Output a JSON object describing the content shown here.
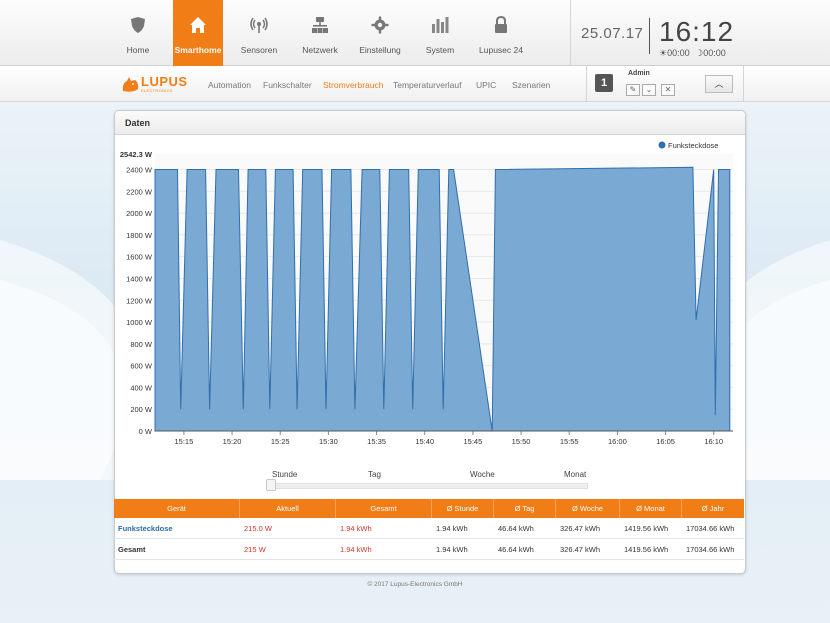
{
  "nav": {
    "items": [
      {
        "label": "Home",
        "icon": "shield-icon"
      },
      {
        "label": "Smarthome",
        "icon": "house-icon",
        "active": true
      },
      {
        "label": "Sensoren",
        "icon": "signal-icon"
      },
      {
        "label": "Netzwerk",
        "icon": "network-icon"
      },
      {
        "label": "Einstellung",
        "icon": "gear-icon"
      },
      {
        "label": "System",
        "icon": "bars-icon"
      },
      {
        "label": "Lupusec 24",
        "icon": "lock-icon"
      }
    ],
    "active_color": "#f07d16"
  },
  "clock": {
    "date": "25.07.17",
    "time": "16:12",
    "sunrise": "00:00",
    "sunset": "00:00"
  },
  "subnav": {
    "logo_text": "LUPUS",
    "logo_tagline": "ELECTRONICS",
    "items": [
      {
        "label": "Automation"
      },
      {
        "label": "Funkschalter"
      },
      {
        "label": "Stromverbrauch",
        "active": true
      },
      {
        "label": "Temperaturverlauf"
      },
      {
        "label": "UPIC"
      },
      {
        "label": "Szenarien"
      }
    ]
  },
  "user": {
    "badge": "1",
    "name": "Admin"
  },
  "panel": {
    "title": "Daten"
  },
  "chart_data": {
    "type": "area",
    "title": "",
    "legend": [
      "Funksteckdose"
    ],
    "legend_position": "top-right",
    "series_color": "#7aa9d3",
    "line_color": "#2f6fae",
    "y_max_label": "2542.3 W",
    "ylim": [
      0,
      2542.3
    ],
    "y_ticks": [
      "0 W",
      "200 W",
      "400 W",
      "600 W",
      "800 W",
      "1000 W",
      "1200 W",
      "1400 W",
      "1600 W",
      "1800 W",
      "2000 W",
      "2200 W",
      "2400 W"
    ],
    "x_ticks": [
      "15:15",
      "15:20",
      "15:25",
      "15:30",
      "15:35",
      "15:40",
      "15:45",
      "15:50",
      "15:55",
      "16:00",
      "16:05",
      "16:10"
    ],
    "grid": true,
    "series": [
      {
        "name": "Funksteckdose",
        "x": [
          "15:12:00",
          "15:14:20",
          "15:14:40",
          "15:15:20",
          "15:17:15",
          "15:17:40",
          "15:18:20",
          "15:20:40",
          "15:21:10",
          "15:21:40",
          "15:23:30",
          "15:23:55",
          "15:24:30",
          "15:26:20",
          "15:26:45",
          "15:27:20",
          "15:29:20",
          "15:29:45",
          "15:30:20",
          "15:32:20",
          "15:32:45",
          "15:33:30",
          "15:35:20",
          "15:35:45",
          "15:36:20",
          "15:38:20",
          "15:38:45",
          "15:39:20",
          "15:41:30",
          "15:41:55",
          "15:42:30",
          "15:43:00",
          "15:47:00",
          "15:47:20",
          "16:07:50",
          "16:08:10",
          "16:10:00",
          "16:10:10",
          "16:10:30",
          "16:10:50",
          "16:11:40"
        ],
        "y": [
          2400,
          2400,
          200,
          2400,
          2400,
          200,
          2400,
          2400,
          200,
          2400,
          2400,
          200,
          2400,
          2400,
          200,
          2400,
          2400,
          200,
          2400,
          2400,
          200,
          2400,
          2400,
          200,
          2400,
          2400,
          200,
          2400,
          2400,
          200,
          2400,
          2400,
          0,
          2400,
          2420,
          1020,
          2400,
          150,
          2400,
          2400,
          2400
        ]
      }
    ]
  },
  "range_slider": {
    "labels": [
      "Stunde",
      "Tag",
      "Woche",
      "Monat"
    ]
  },
  "table": {
    "headers": [
      "Gerät",
      "Aktuell",
      "Gesamt",
      "Ø Stunde",
      "Ø Tag",
      "Ø Woche",
      "Ø Monat",
      "Ø Jahr"
    ],
    "rows": [
      [
        "Funksteckdose",
        "215.0 W",
        "1.94 kWh",
        "1.94 kWh",
        "46.64 kWh",
        "326.47 kWh",
        "1419.56 kWh",
        "17034.66 kWh"
      ],
      [
        "Gesamt",
        "215 W",
        "1.94 kWh",
        "1.94 kWh",
        "46.64 kWh",
        "326.47 kWh",
        "1419.56 kWh",
        "17034.66 kWh"
      ]
    ]
  },
  "footer": "© 2017 Lupus-Electronics GmbH"
}
